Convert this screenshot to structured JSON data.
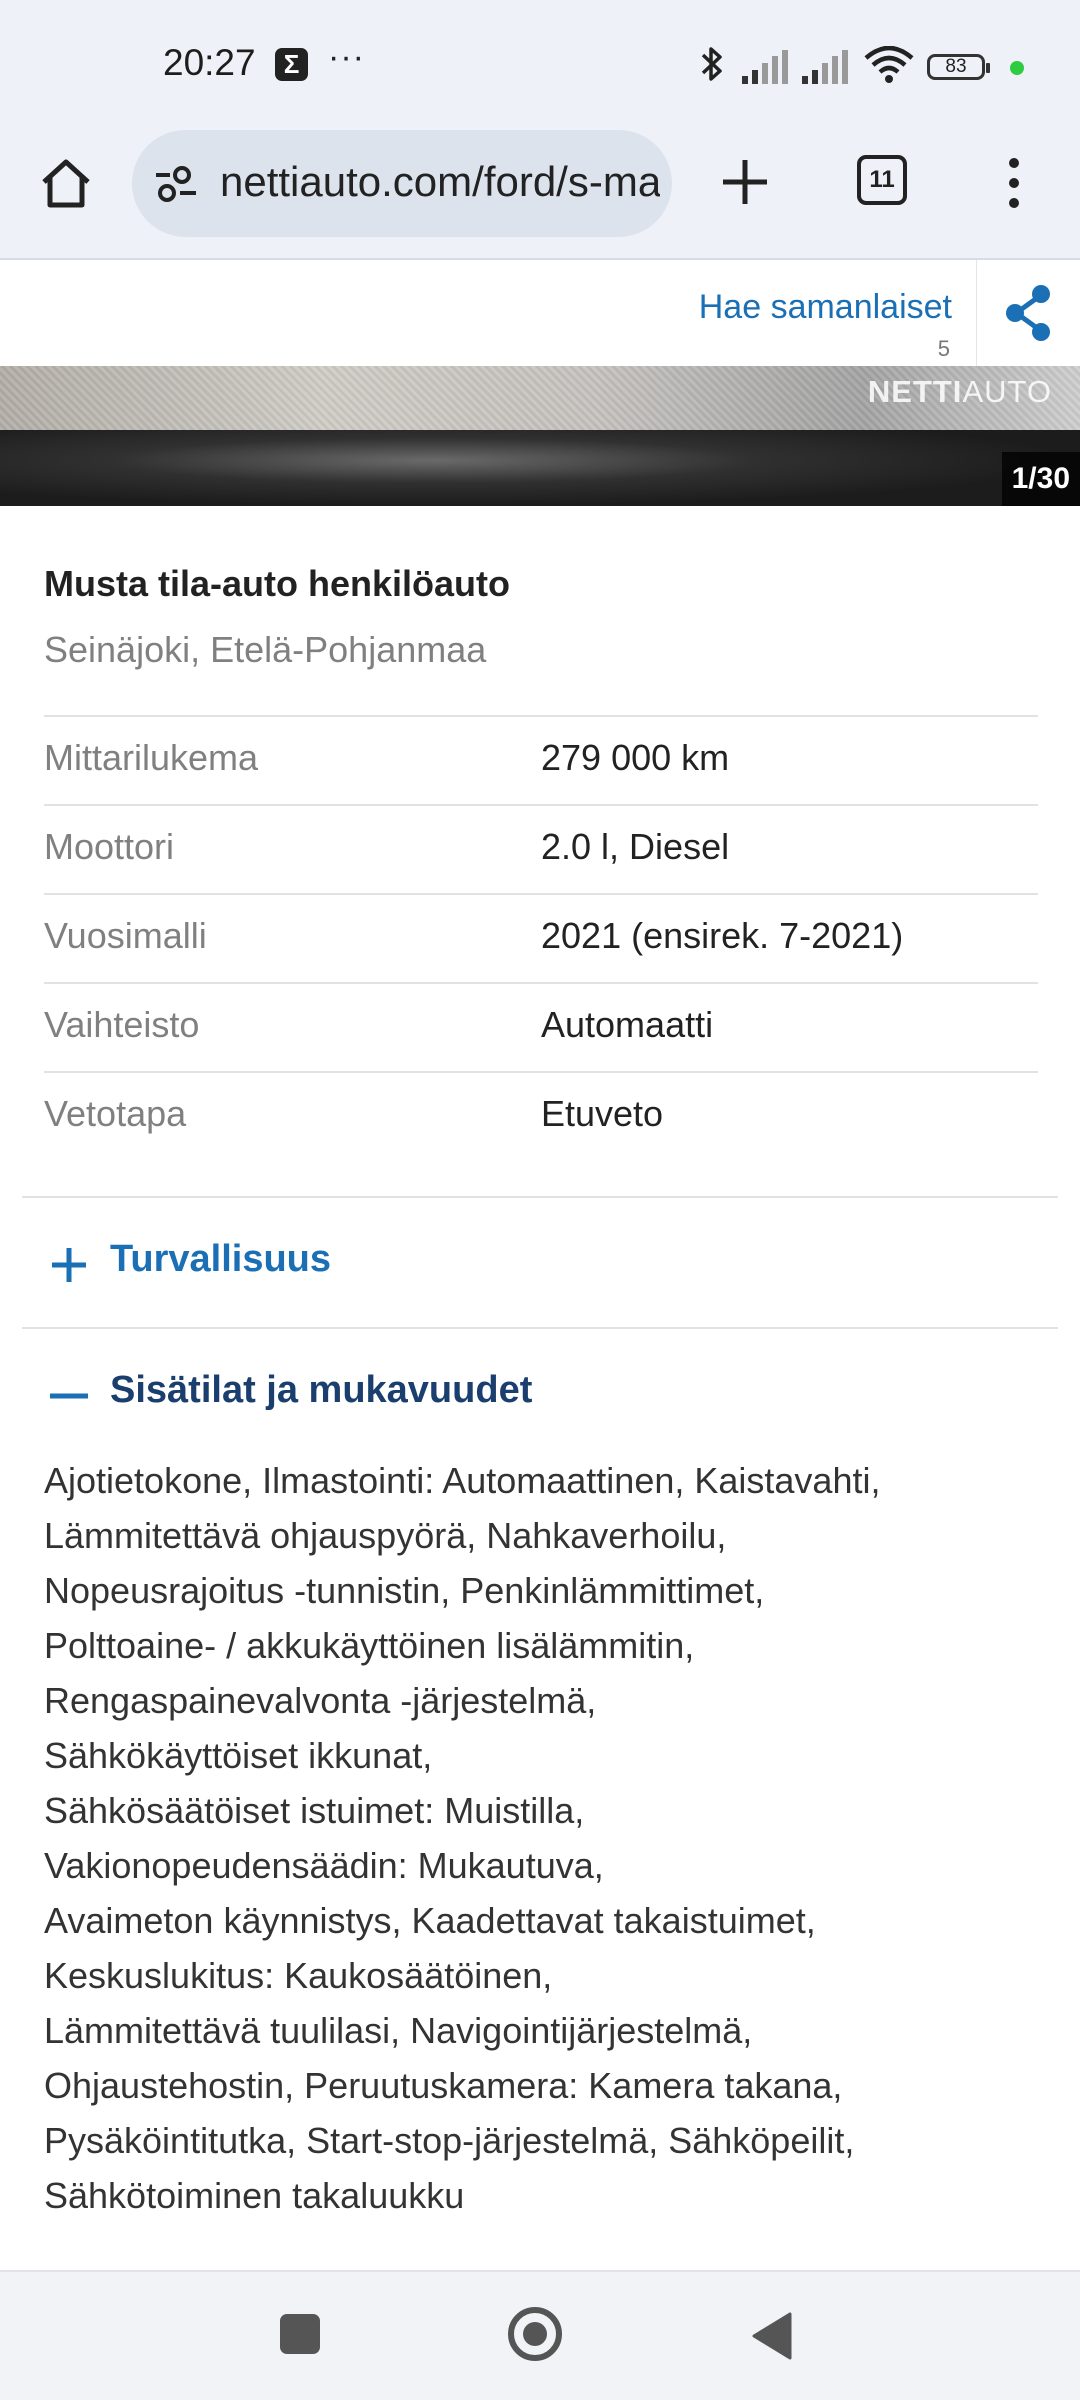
{
  "status_bar": {
    "time": "20:27",
    "sigma_icon": "Σ",
    "overflow": "···",
    "battery": "83"
  },
  "browser": {
    "url": "nettiauto.com/ford/s-max",
    "tab_count": "11"
  },
  "actions": {
    "similar_label": "Hae samanlaiset",
    "similar_count": "5"
  },
  "gallery": {
    "watermark_bold": "NETTI",
    "watermark_light": "AUTO",
    "counter": "1/30"
  },
  "listing": {
    "title": "Musta tila-auto henkilöauto",
    "location": "Seinäjoki, Etelä-Pohjanmaa",
    "specs": [
      {
        "label": "Mittarilukema",
        "value": "279 000 km"
      },
      {
        "label": "Moottori",
        "value": "2.0 l, Diesel"
      },
      {
        "label": "Vuosimalli",
        "value": "2021 (ensirek. 7-2021)"
      },
      {
        "label": "Vaihteisto",
        "value": "Automaatti"
      },
      {
        "label": "Vetotapa",
        "value": "Etuveto"
      }
    ]
  },
  "sections": {
    "safety": {
      "title": "Turvallisuus",
      "state": "collapsed"
    },
    "interior": {
      "title": "Sisätilat ja mukavuudet",
      "state": "expanded",
      "features": [
        "Ajotietokone, Ilmastointi: Automaattinen, Kaistavahti,",
        "Lämmitettävä ohjauspyörä, Nahkaverhoilu,",
        "Nopeusrajoitus -tunnistin, Penkinlämmittimet,",
        "Polttoaine- / akkukäyttöinen lisälämmitin,",
        "Rengaspainevalvonta -järjestelmä,",
        "Sähkökäyttöiset ikkunat,",
        "Sähkösäätöiset istuimet: Muistilla,",
        "Vakionopeudensäädin: Mukautuva,",
        "Avaimeton käynnistys, Kaadettavat takaistuimet,",
        "Keskuslukitus: Kaukosäätöinen,",
        "Lämmitettävä tuulilasi, Navigointijärjestelmä,",
        "Ohjaustehostin, Peruutuskamera: Kamera takana,",
        "Pysäköintitutka, Start-stop-järjestelmä, Sähköpeilit,",
        "Sähkötoiminen takaluukku"
      ]
    }
  },
  "colors": {
    "link_blue": "#1b6fb5",
    "heading_dark_blue": "#1a3f6e",
    "muted_gray": "#808080"
  },
  "icons": [
    "home-icon",
    "site-settings-icon",
    "plus-icon",
    "tab-switcher-icon",
    "more-vert-icon",
    "share-icon",
    "bluetooth-icon",
    "signal-icon",
    "wifi-icon",
    "battery-icon",
    "expand-plus-icon",
    "collapse-minus-icon",
    "nav-recents-icon",
    "nav-home-icon",
    "nav-back-icon"
  ]
}
